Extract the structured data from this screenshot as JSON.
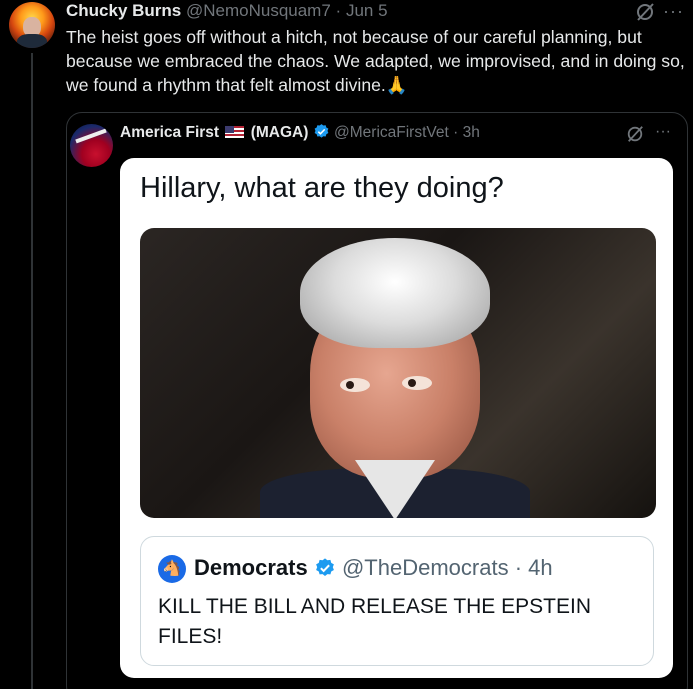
{
  "tweet": {
    "display_name": "Chucky Burns",
    "handle": "@NemoNusquam7",
    "separator": "·",
    "date": "Jun 5",
    "text": "The heist goes off without a hitch, not because of our careful planning, but because we embraced the chaos. We adapted, we improvised, and in doing so, we found a rhythm that felt almost divine.",
    "emoji": "🙏",
    "more": "···"
  },
  "quote": {
    "display_name": "America First",
    "tag": "(MAGA)",
    "handle": "@MericaFirstVet",
    "separator": "·",
    "time": "3h",
    "more": "···",
    "meme": {
      "caption": "Hillary, what are they doing?",
      "inner": {
        "name": "Democrats",
        "handle": "@TheDemocrats",
        "separator": "·",
        "time": "4h",
        "text": "KILL THE BILL AND RELEASE THE EPSTEIN FILES!"
      }
    }
  },
  "colors": {
    "background": "#000000",
    "text_primary": "#e7e9ea",
    "text_secondary": "#71767b",
    "verified_blue": "#1d9bf0",
    "dem_blue": "#1a6ae6"
  },
  "icons": [
    "grok-icon",
    "more-icon",
    "verified-icon",
    "flag-us-icon",
    "democrats-logo-icon"
  ]
}
